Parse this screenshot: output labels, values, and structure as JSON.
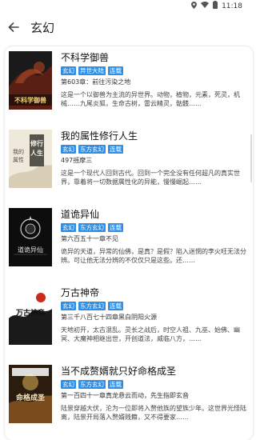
{
  "status": {
    "time": "11:18"
  },
  "header": {
    "title": "玄幻"
  },
  "books": [
    {
      "title": "不科学御兽",
      "tags": [
        "玄幻",
        "异世大陆",
        "连载"
      ],
      "chapter": "第603章：前往污染之地",
      "desc": "这是一个以御兽为主流的异世界。动物，植物，元素，死灵，机械……九尾炎狐，生命古树，雷云精灵，骷髅……",
      "cover_colors": [
        "#1b1b1b",
        "#5a1f14",
        "#b8451e"
      ],
      "cover_text": "不科学御兽"
    },
    {
      "title": "我的属性修行人生",
      "tags": [
        "玄幻",
        "东方玄幻",
        "连载"
      ],
      "chapter": "497摇摩三",
      "desc": "这是一个现代人回到古代。回到一个完全没有任何超凡的真实世界，靠着将一切数据属性化的异能，慢慢崛起……",
      "cover_colors": [
        "#f2ede1",
        "#d8cfb6",
        "#3a3a32"
      ],
      "cover_text": "修行人生"
    },
    {
      "title": "道诡异仙",
      "tags": [
        "玄幻",
        "东方玄幻",
        "连载"
      ],
      "chapter": "第六百五十一章不见",
      "desc": "诡异的天道，异常的仙佛，是真？是假？陷入迷惘的李火旺无法分辨。可让他无法分辨的不仅仅只是这些。还……",
      "cover_colors": [
        "#0d0d0d",
        "#2b2b2b",
        "#e8e8e8"
      ],
      "cover_text": "道诡异仙"
    },
    {
      "title": "万古神帝",
      "tags": [
        "玄幻",
        "东方玄幻",
        "连载"
      ],
      "chapter": "第三千八百七十四章黑白阴阳火源",
      "desc": "天地初开，太古混乱。灵长之战后，时空人祖、九巫、始佛、幽冥、大魔神相继出世，开创道法，威临八方，……",
      "cover_colors": [
        "#ffffff",
        "#c92a1b",
        "#111111"
      ],
      "cover_text": "万古神帝"
    },
    {
      "title": "当不成赘婿就只好命格成圣",
      "tags": [
        "玄幻",
        "东方玄幻",
        "连载"
      ],
      "chapter": "第一百四十一章真龙悬云而动，先生指即玄音",
      "desc": "陆景穿越大伏，沦为一位即将入赘他族的望族少年。这世界光怪陆离，陆景开局落入赘婿贱籍，又不得要家……",
      "cover_colors": [
        "#2a1d10",
        "#7a4b1c",
        "#e0b25a"
      ],
      "cover_text": "命格成圣"
    }
  ]
}
